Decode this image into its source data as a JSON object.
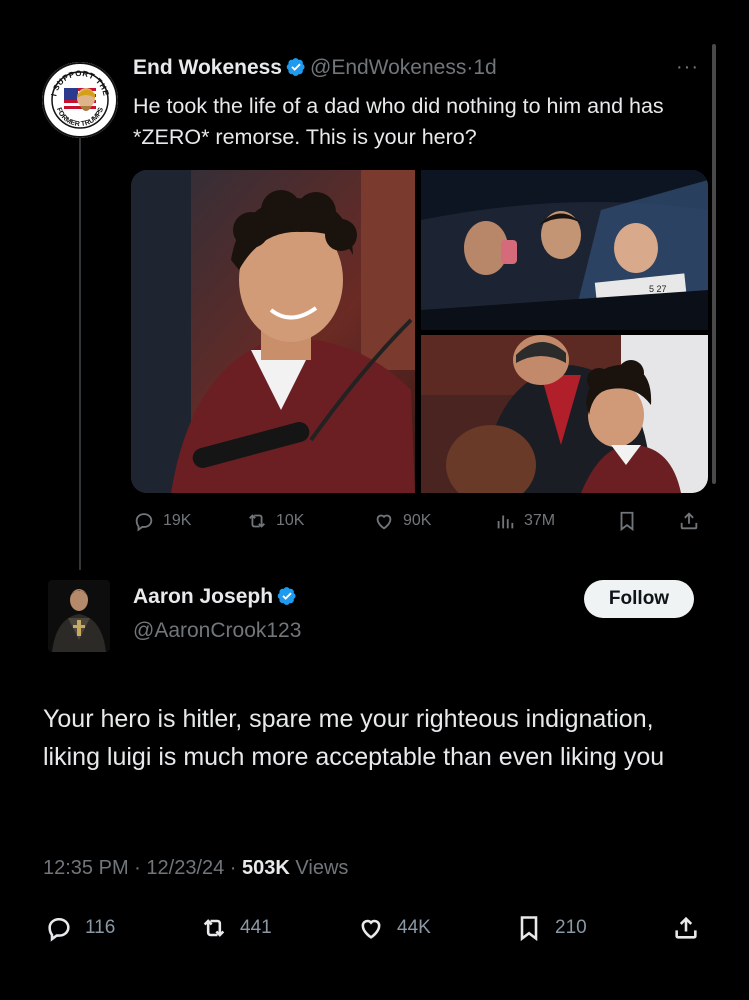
{
  "tweet": {
    "author_name": "End Wokeness",
    "handle": "@EndWokeness",
    "separator": "·",
    "age": "1d",
    "more_label": "···",
    "text": "He took the life of a dad who did nothing to him and has *ZERO* remorse. This is your hero?",
    "avatar_text_top": "I SUPPORT THE",
    "avatar_text_bottom": "FORMER TRUMPS",
    "media_plate": "5 27",
    "actions": {
      "replies": "19K",
      "reposts": "10K",
      "likes": "90K",
      "views": "37M"
    }
  },
  "reply": {
    "author_name": "Aaron Joseph",
    "handle": "@AaronCrook123",
    "follow_label": "Follow",
    "text": "Your hero is hitler, spare me your righteous indignation, liking luigi is much more acceptable than even liking you",
    "time": "12:35 PM",
    "date": "12/23/24",
    "views_count": "503K",
    "views_label": "Views",
    "actions": {
      "replies": "116",
      "reposts": "441",
      "likes": "44K",
      "bookmarks": "210"
    }
  },
  "colors": {
    "background": "#000000",
    "verified": "#1d9bf0",
    "muted": "#71767b",
    "text": "#e7e9ea"
  }
}
